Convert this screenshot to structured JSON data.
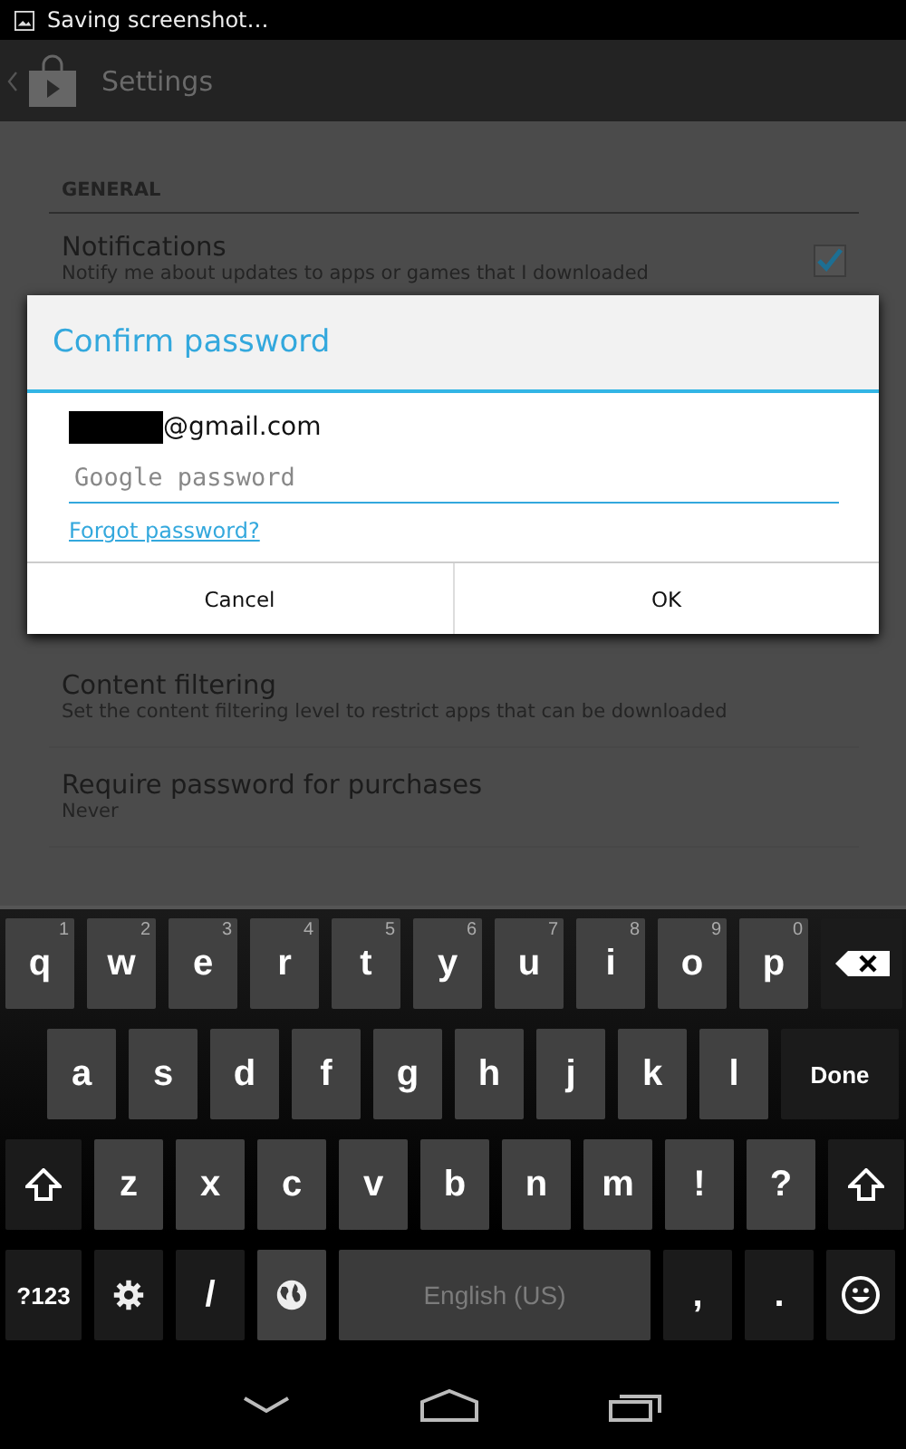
{
  "status_bar": {
    "notification": "Saving screenshot…"
  },
  "action_bar": {
    "title": "Settings"
  },
  "settings": {
    "section": "GENERAL",
    "items": [
      {
        "title": "Notifications",
        "summary": "Notify me about updates to apps or games that I downloaded",
        "kind": "checkbox",
        "checked": true
      },
      {
        "title": "Content filtering",
        "summary": "Set the content filtering level to restrict apps that can be downloaded",
        "kind": "plain"
      },
      {
        "title": "Require password for purchases",
        "summary": "Never",
        "kind": "plain"
      }
    ]
  },
  "dialog": {
    "title": "Confirm password",
    "account": "@gmail.com",
    "password": {
      "placeholder": "Google password"
    },
    "link": "Forgot password?",
    "buttons": [
      "Cancel",
      "OK"
    ]
  },
  "keyboard": {
    "rows": [
      {
        "keys": [
          {
            "kind": "letter",
            "label": "q",
            "hint": "1"
          },
          {
            "kind": "letter",
            "label": "w",
            "hint": "2"
          },
          {
            "kind": "letter",
            "label": "e",
            "hint": "3"
          },
          {
            "kind": "letter",
            "label": "r",
            "hint": "4"
          },
          {
            "kind": "letter",
            "label": "t",
            "hint": "5"
          },
          {
            "kind": "letter",
            "label": "y",
            "hint": "6"
          },
          {
            "kind": "letter",
            "label": "u",
            "hint": "7"
          },
          {
            "kind": "letter",
            "label": "i",
            "hint": "8"
          },
          {
            "kind": "letter",
            "label": "o",
            "hint": "9"
          },
          {
            "kind": "letter",
            "label": "p",
            "hint": "0"
          },
          {
            "kind": "backspace"
          }
        ]
      },
      {
        "keys": [
          {
            "kind": "letter",
            "label": "a"
          },
          {
            "kind": "letter",
            "label": "s"
          },
          {
            "kind": "letter",
            "label": "d"
          },
          {
            "kind": "letter",
            "label": "f"
          },
          {
            "kind": "letter",
            "label": "g"
          },
          {
            "kind": "letter",
            "label": "h"
          },
          {
            "kind": "letter",
            "label": "j"
          },
          {
            "kind": "letter",
            "label": "k"
          },
          {
            "kind": "letter",
            "label": "l"
          },
          {
            "kind": "done",
            "label": "Done"
          }
        ]
      },
      {
        "keys": [
          {
            "kind": "shift"
          },
          {
            "kind": "letter",
            "label": "z"
          },
          {
            "kind": "letter",
            "label": "x"
          },
          {
            "kind": "letter",
            "label": "c"
          },
          {
            "kind": "letter",
            "label": "v"
          },
          {
            "kind": "letter",
            "label": "b"
          },
          {
            "kind": "letter",
            "label": "n"
          },
          {
            "kind": "letter",
            "label": "m"
          },
          {
            "kind": "letter",
            "label": "!"
          },
          {
            "kind": "letter",
            "label": "?"
          },
          {
            "kind": "shift"
          }
        ]
      },
      {
        "keys": [
          {
            "kind": "symbols",
            "label": "?123"
          },
          {
            "kind": "settings"
          },
          {
            "kind": "dark",
            "label": "/"
          },
          {
            "kind": "globe"
          },
          {
            "kind": "space",
            "label": "English (US)"
          },
          {
            "kind": "dark",
            "label": ","
          },
          {
            "kind": "dark",
            "label": "."
          },
          {
            "kind": "emoji"
          }
        ]
      }
    ]
  }
}
